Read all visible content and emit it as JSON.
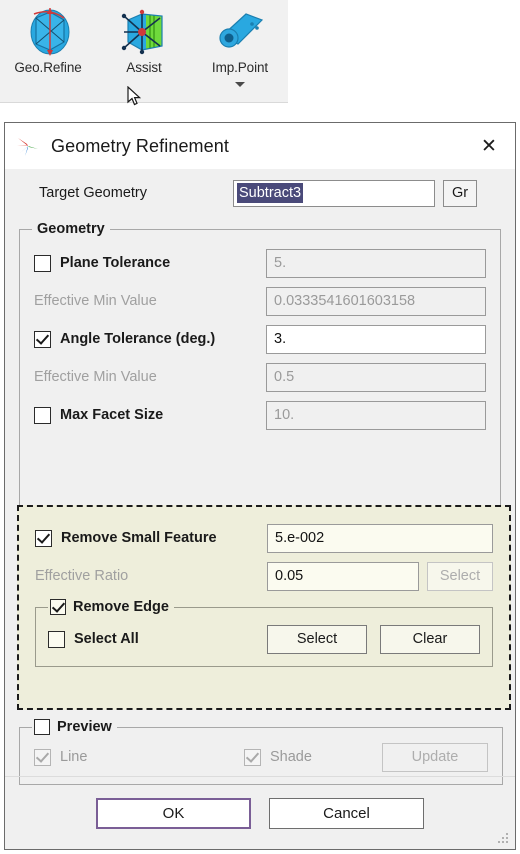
{
  "ribbon": {
    "items": [
      {
        "label": "Geo.Refine",
        "icon": "geo-refine-icon",
        "has_dropdown": false
      },
      {
        "label": "Assist",
        "icon": "assist-icon",
        "has_dropdown": false
      },
      {
        "label": "Imp.Point",
        "icon": "imp-point-icon",
        "has_dropdown": true
      }
    ]
  },
  "dialog": {
    "title": "Geometry Refinement",
    "title_icon": "colored-star-icon",
    "close_label": "✕",
    "target": {
      "label": "Target Geometry",
      "value": "Subtract3",
      "browse_button": "Gr"
    },
    "geometry_group": {
      "title": "Geometry",
      "rows": [
        {
          "label": "Plane Tolerance",
          "checked": false,
          "value": "5.",
          "field_state": "disabled"
        },
        {
          "label": "Effective Min Value",
          "checked": null,
          "value": "0.0333541601603158",
          "field_state": "disabled"
        },
        {
          "label": "Angle Tolerance (deg.)",
          "checked": true,
          "value": "3.",
          "field_state": "active"
        },
        {
          "label": "Effective Min Value",
          "checked": null,
          "value": "0.5",
          "field_state": "disabled"
        },
        {
          "label": "Max Facet Size",
          "checked": false,
          "value": "10.",
          "field_state": "disabled"
        }
      ]
    },
    "highlight": {
      "remove_small_feature": {
        "label": "Remove Small Feature",
        "checked": true,
        "value": "5.e-002"
      },
      "effective_ratio": {
        "label": "Effective Ratio",
        "value": "0.05",
        "select_button": "Select"
      },
      "remove_edge_group": {
        "title": "Remove Edge",
        "checked": true,
        "select_all": {
          "label": "Select All",
          "checked": false
        },
        "select_button": "Select",
        "clear_button": "Clear"
      }
    },
    "preview_group": {
      "title": "Preview",
      "checked": false,
      "line": {
        "label": "Line",
        "checked": true
      },
      "shade": {
        "label": "Shade",
        "checked": true
      },
      "update_button": "Update"
    },
    "footer": {
      "ok": "OK",
      "cancel": "Cancel"
    }
  },
  "colors": {
    "selection_highlight": "#4a4a7a",
    "annotation_border": "#1a1a1a",
    "annotation_fill": "#eeeedb",
    "default_button_border": "#7a5e96",
    "dialog_bg": "#f0f0f0"
  }
}
